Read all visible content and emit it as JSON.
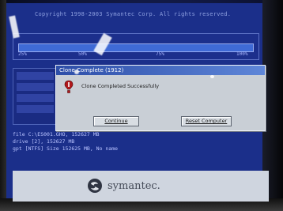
{
  "copyright": "Copyright 1998-2003 Symantec Corp. All rights reserved.",
  "progress": {
    "fraction": 1.0,
    "ticks": [
      "25%",
      "50%",
      "75%",
      "100%"
    ]
  },
  "dialog": {
    "title": "Clone Complete (1912)",
    "message": "Clone Completed Successfully",
    "continue_label": "Continue",
    "reboot_label": "Reset Computer",
    "icon": "error-icon"
  },
  "log_lines": [
    "file C:\\ES001.GHO, 152627 MB",
    "drive [2], 152627 MB",
    "gpt [NTFS] Size 152625 MB, No name"
  ],
  "footer": {
    "logo_text": "symantec."
  },
  "colors": {
    "background": "#1b2f8a",
    "dialog": "#c9cfd6",
    "title_bar": "#2d4ea8",
    "footer": "#cfd5df"
  }
}
